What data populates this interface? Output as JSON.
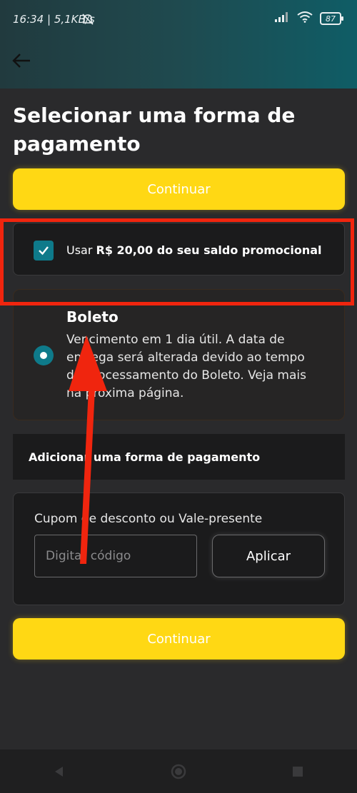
{
  "status": {
    "time": "16:34 | 5,1KB/s",
    "battery": "87",
    "icons": [
      "mute-icon",
      "signal-icon",
      "wifi-icon",
      "battery-icon"
    ]
  },
  "appbar": {
    "back_icon": "arrow-left-icon"
  },
  "page": {
    "title": "Selecionar uma forma de pagamento",
    "continue_top": "Continuar",
    "continue_bottom": "Continuar"
  },
  "promo": {
    "prefix": "Usar ",
    "amount_bold": "R$ 20,00 do seu saldo promocional",
    "checked": true
  },
  "boleto": {
    "title": "Boleto",
    "description": "Vencimento em 1 dia útil. A data de entrega será alterada devido ao tempo de processamento do Boleto. Veja mais na próxima página.",
    "selected": true
  },
  "add_payment": {
    "label": "Adicionar uma forma de pagamento"
  },
  "coupon": {
    "label": "Cupom de desconto ou Vale-presente",
    "placeholder": "Digitar código",
    "apply_label": "Aplicar"
  },
  "colors": {
    "accent_yellow": "#ffd814",
    "teal": "#0e7a8a",
    "highlight_red": "#f0250e",
    "background": "#2a2a2c"
  }
}
